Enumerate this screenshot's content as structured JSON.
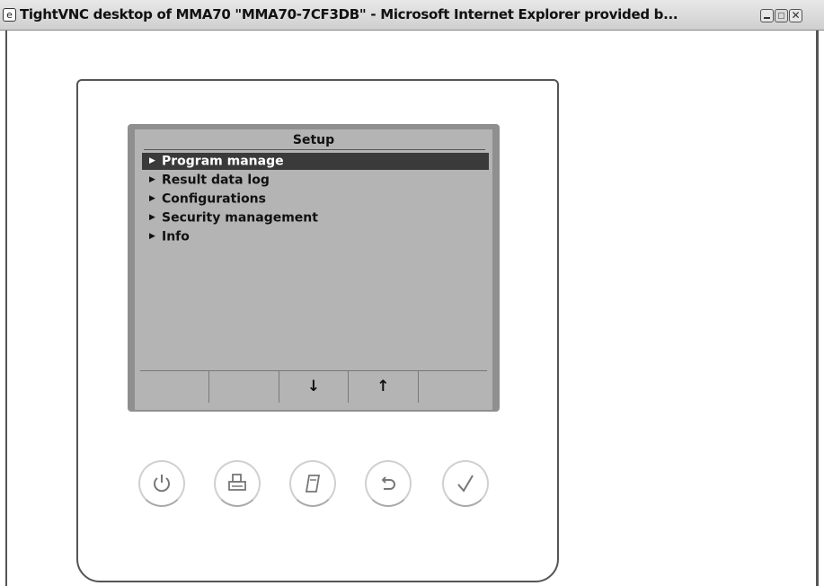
{
  "window": {
    "title": "TightVNC desktop of MMA70 \"MMA70-7CF3DB\" - Microsoft Internet Explorer provided b...",
    "icon": "ie-icon"
  },
  "lcd": {
    "title": "Setup",
    "menu": [
      {
        "label": "Program manage",
        "selected": true
      },
      {
        "label": "Result data log",
        "selected": false
      },
      {
        "label": "Configurations",
        "selected": false
      },
      {
        "label": "Security management",
        "selected": false
      },
      {
        "label": "Info",
        "selected": false
      }
    ],
    "softkeys": [
      "",
      "",
      "↓",
      "↑",
      ""
    ]
  },
  "hardware_buttons": [
    {
      "icon": "power-icon"
    },
    {
      "icon": "print-icon"
    },
    {
      "icon": "memo-icon"
    },
    {
      "icon": "back-icon"
    },
    {
      "icon": "check-icon"
    }
  ]
}
